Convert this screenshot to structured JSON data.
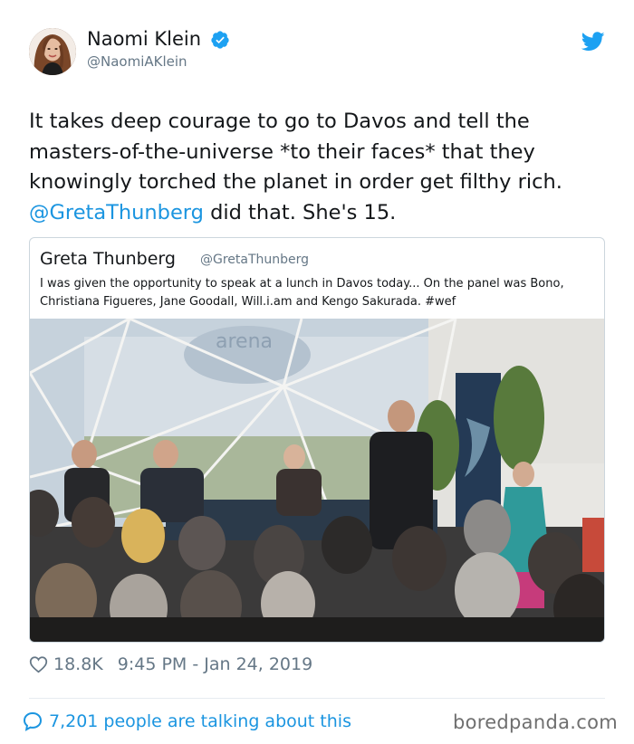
{
  "author": {
    "name": "Naomi Klein",
    "handle": "@NaomiAKlein",
    "verified": true,
    "avatar_icon": "profile-photo"
  },
  "tweet": {
    "text_before": "It takes deep courage to go to Davos and tell the masters-of-the-universe *to their faces* that they knowingly torched the planet in order get filthy rich. ",
    "mention": "@GretaThunberg",
    "text_after": " did that. She's 15."
  },
  "quoted_tweet": {
    "name": "Greta Thunberg",
    "handle": "@GretaThunberg",
    "text": "I was given the opportunity to speak at a lunch in Davos today... On the panel was Bono, Christiana Figueres, Jane Goodall, Will.i.am and Kengo Sakurada. #wef",
    "photo_sign": "arena"
  },
  "footer": {
    "likes": "18.8K",
    "timestamp": "9:45 PM - Jan 24, 2019",
    "talking": "7,201 people are talking about this"
  },
  "watermark": "boredpanda.com",
  "colors": {
    "link": "#1b95e0",
    "text": "#14171a",
    "muted": "#657786",
    "border": "#ccd6dd"
  }
}
